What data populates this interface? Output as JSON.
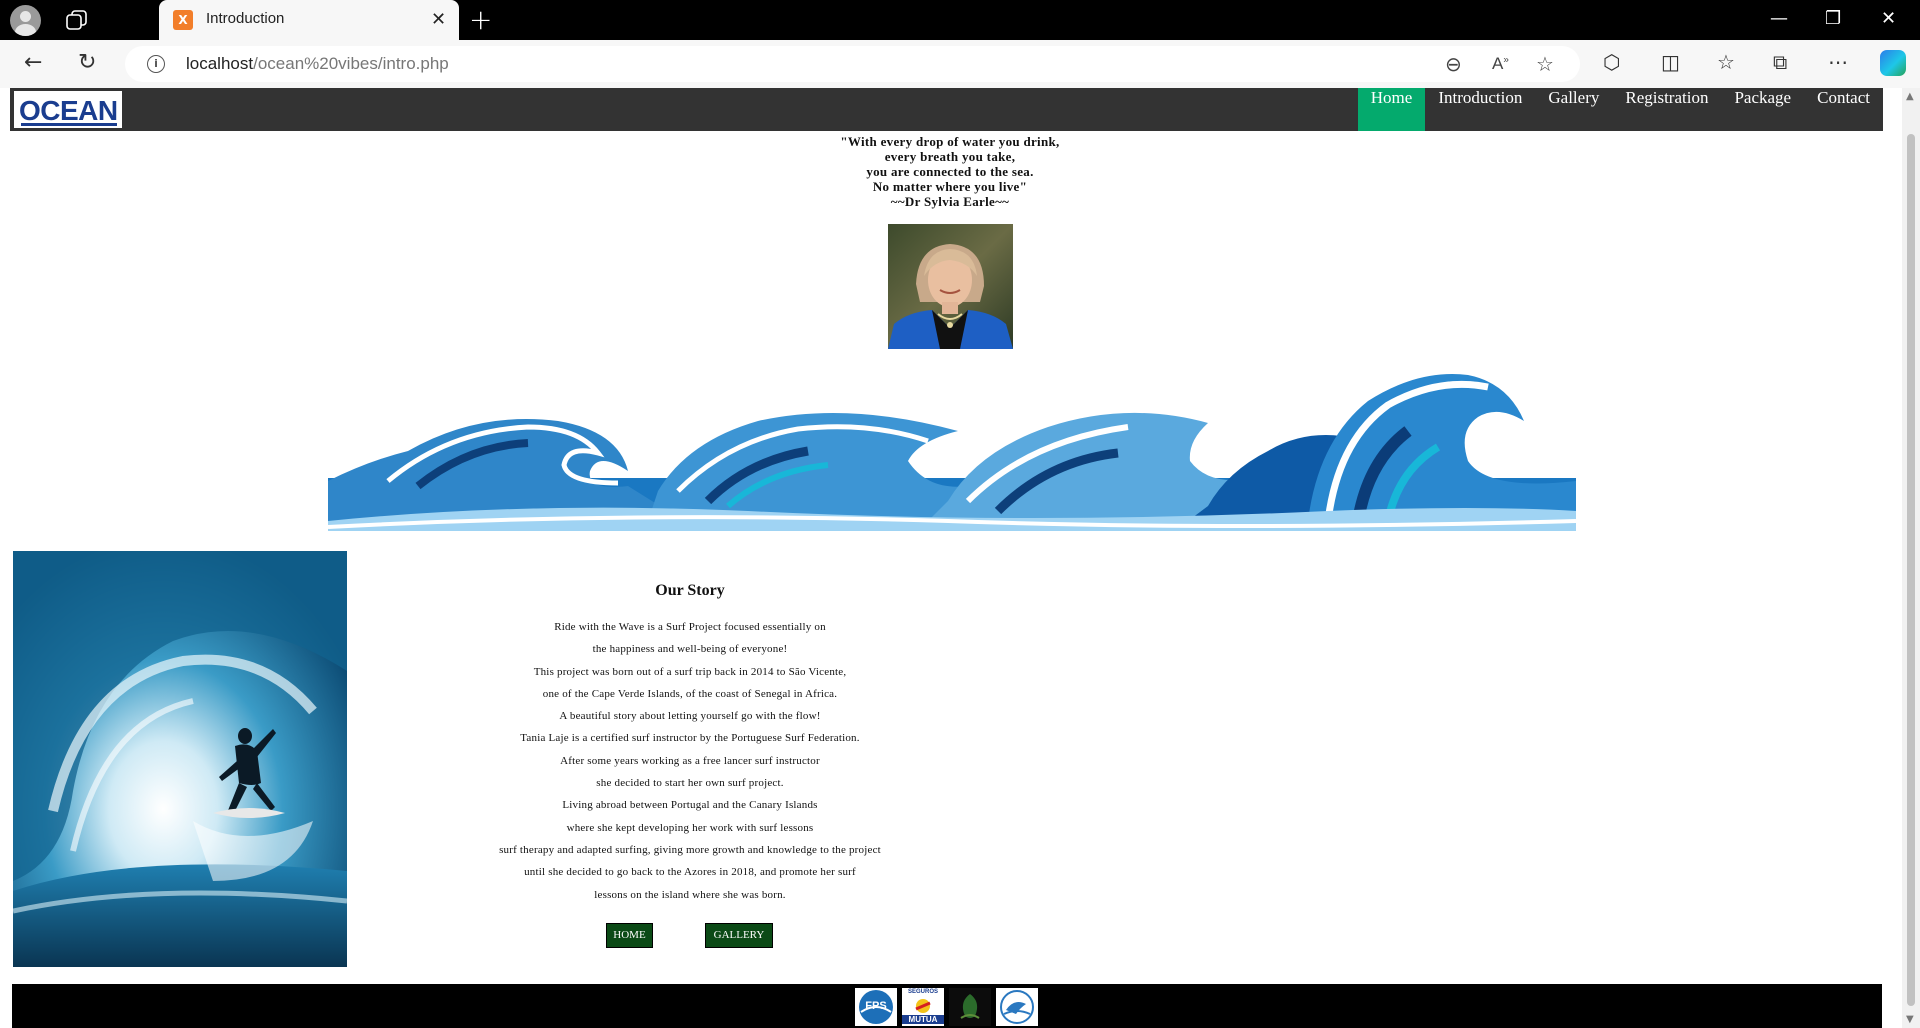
{
  "browser": {
    "tab_title": "Introduction",
    "tab_favicon": "X",
    "url_host": "localhost",
    "url_path": "/ocean%20vibes/intro.php"
  },
  "site": {
    "logo": "OCEAN",
    "nav": [
      "Home",
      "Introduction",
      "Gallery",
      "Registration",
      "Package",
      "Contact"
    ],
    "active_nav": "Home"
  },
  "quote": {
    "lines": [
      "\"With every drop of water you drink,",
      "every breath you take,",
      "you are connected to the sea.",
      "No matter where you live\"",
      "~~Dr Sylvia Earle~~"
    ]
  },
  "story": {
    "title": "Our Story",
    "lines": [
      "Ride with the Wave is a Surf Project focused essentially on",
      "the happiness and well-being of everyone!",
      "This project was born out of a surf trip back in 2014 to São Vicente,",
      "one of the Cape Verde Islands, of the coast of Senegal in Africa.",
      "A beautiful story about letting yourself go with the flow!",
      "Tania Laje is a certified surf instructor by the Portuguese Surf Federation.",
      "After some years working as a free lancer surf instructor",
      "she decided to start her own surf project.",
      "Living abroad between Portugal and the Canary Islands",
      "where she kept developing her work with surf lessons",
      "surf therapy and adapted surfing, giving more growth and knowledge to the project",
      "until she decided to go back to the Azores in 2018, and promote her surf",
      "lessons on the island where she was born."
    ],
    "buttons": {
      "home": "HOME",
      "gallery": "GALLERY"
    }
  },
  "footer": {
    "sponsors": [
      {
        "name": "FPS",
        "label": "FPS"
      },
      {
        "name": "Seguros Mutua",
        "label_top": "SEGUROS",
        "label_bottom": "MUTUA"
      },
      {
        "name": "leaf-logo"
      },
      {
        "name": "surf-logo"
      }
    ]
  },
  "colors": {
    "nav_bg": "#333333",
    "nav_active": "#04aa6d",
    "button_bg": "#0b4a16",
    "footer_bg": "#000000",
    "logo_blue": "#1a3d8f"
  }
}
